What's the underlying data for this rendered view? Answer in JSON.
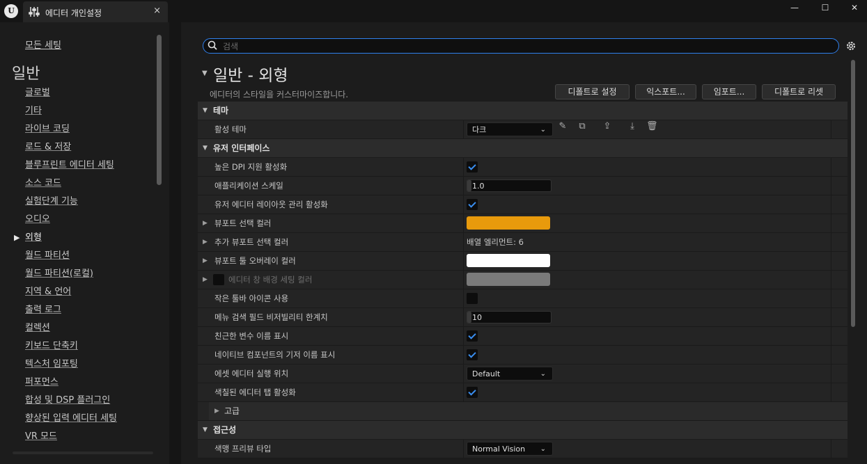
{
  "window": {
    "logo_text": "U",
    "tab_title": "에디터 개인설정",
    "tab_icon": "sliders-icon",
    "close_glyph": "×",
    "minimize_glyph": "—",
    "maximize_glyph": "☐",
    "window_close_glyph": "✕"
  },
  "sidebar": {
    "all_settings": "모든 세팅",
    "heading": "일반",
    "items": [
      {
        "label": "글로벌"
      },
      {
        "label": "기타"
      },
      {
        "label": "라이브 코딩"
      },
      {
        "label": "로드 & 저장"
      },
      {
        "label": "블루프린트 에디터 세팅"
      },
      {
        "label": "소스 코드"
      },
      {
        "label": "실험단계 기능"
      },
      {
        "label": "오디오"
      },
      {
        "label": "외형",
        "active": true
      },
      {
        "label": "월드 파티션"
      },
      {
        "label": "월드 파티션(로컬)"
      },
      {
        "label": "지역 & 언어"
      },
      {
        "label": "출력 로그"
      },
      {
        "label": "컬렉션"
      },
      {
        "label": "키보드 단축키"
      },
      {
        "label": "텍스처 임포팅"
      },
      {
        "label": "퍼포먼스"
      },
      {
        "label": "합성 및 DSP 플러그인"
      },
      {
        "label": "향상된 입력 에디터 세팅"
      },
      {
        "label": "VR 모드"
      }
    ]
  },
  "search": {
    "placeholder": "검색"
  },
  "page": {
    "title": "일반 - 외형",
    "description": "에디터의 스타일을 커스터마이즈합니다.",
    "buttons": {
      "set_default": "디폴트로 설정",
      "export": "익스포트...",
      "import": "임포트...",
      "reset_default": "디폴트로 리셋"
    }
  },
  "sections": {
    "theme": {
      "title": "테마",
      "active_theme_label": "활성 테마",
      "active_theme_value": "다크"
    },
    "ui": {
      "title": "유저 인터페이스",
      "high_dpi": {
        "label": "높은 DPI 지원 활성화",
        "checked": true
      },
      "app_scale": {
        "label": "애플리케이션 스케일",
        "value": "1.0"
      },
      "layout_mgmt": {
        "label": "유저 에디터 레이아웃 관리 활성화",
        "checked": true
      },
      "viewport_sel_color": {
        "label": "뷰포트 선택 컬러",
        "color": "#e89a0c"
      },
      "extra_viewport_sel_color": {
        "label": "추가 뷰포트 선택 컬러",
        "value": "배열 엘리먼트: 6"
      },
      "viewport_tool_overlay_color": {
        "label": "뷰포트 툴 오버레이 컬러",
        "color": "#ffffff"
      },
      "editor_window_bg_color": {
        "label": "에디터 창 배경 세팅 컬러",
        "color": "#7a7a7a"
      },
      "small_toolbar_icons": {
        "label": "작은 툴바 아이콘 사용",
        "checked": false
      },
      "menu_search_threshold": {
        "label": "메뉴 검색 필드 비저빌리티 한계치",
        "value": "10"
      },
      "friendly_var_names": {
        "label": "친근한 변수 이름 표시",
        "checked": true
      },
      "native_component_names": {
        "label": "네이티브 컴포넌트의 기저 이름 표시",
        "checked": true
      },
      "asset_editor_location": {
        "label": "에셋 에디터 실행 위치",
        "value": "Default"
      },
      "colored_tabs": {
        "label": "색칠된 에디터 탭 활성화",
        "checked": true
      },
      "advanced": "고급"
    },
    "accessibility": {
      "title": "접근성",
      "color_vision": {
        "label": "색맹 프리뷰 타입",
        "value": "Normal Vision"
      }
    }
  }
}
